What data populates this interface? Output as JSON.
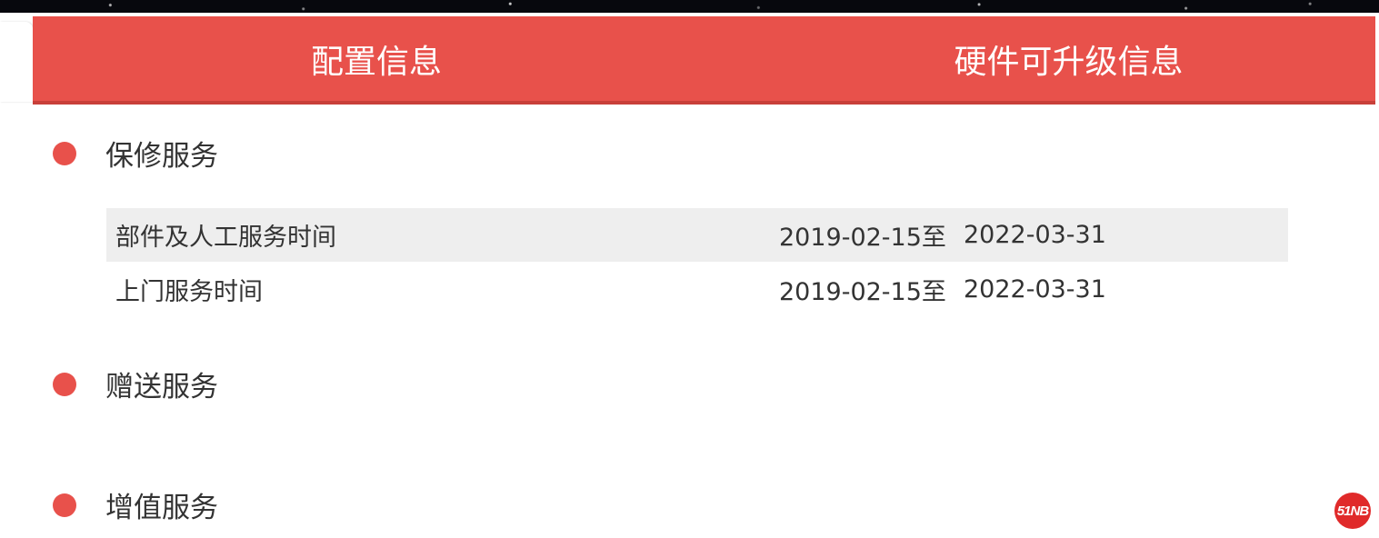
{
  "tabs": [
    {
      "label": "配置信息"
    },
    {
      "label": "硬件可升级信息"
    }
  ],
  "sections": [
    {
      "title": "保修服务",
      "rows": [
        {
          "name": "部件及人工服务时间",
          "start": "2019-02-15至",
          "end": "2022-03-31"
        },
        {
          "name": "上门服务时间",
          "start": "2019-02-15至",
          "end": "2022-03-31"
        }
      ]
    },
    {
      "title": "赠送服务",
      "rows": []
    },
    {
      "title": "增值服务",
      "rows": []
    }
  ],
  "logo": {
    "text": "51NB"
  },
  "colors": {
    "accent": "#e8514b",
    "row_shade": "#eeeeee",
    "text": "#333333"
  }
}
